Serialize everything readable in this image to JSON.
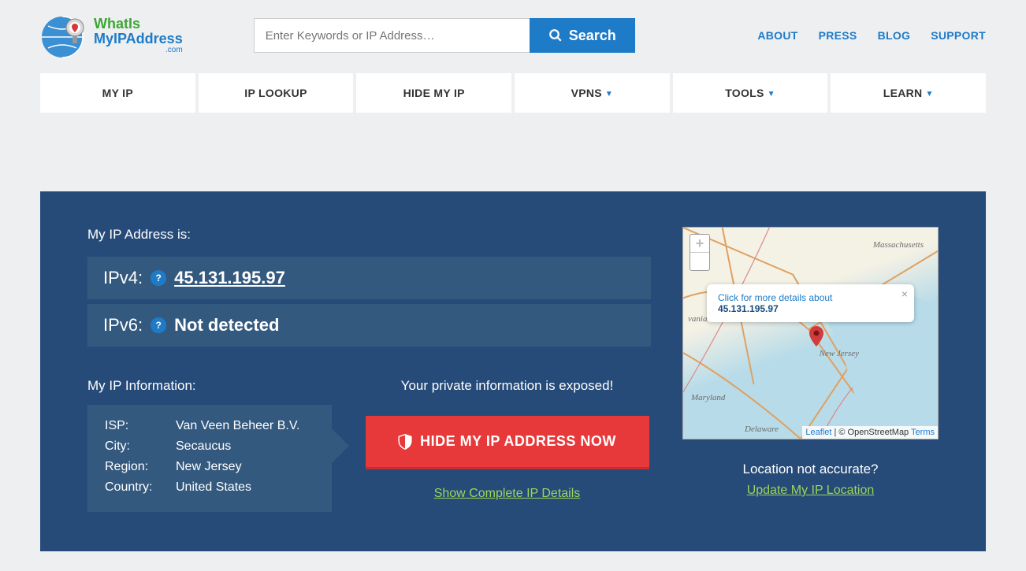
{
  "logo": {
    "line1": "WhatIs",
    "line2": "MyIPAddress",
    "line3": ".com"
  },
  "search": {
    "placeholder": "Enter Keywords or IP Address…",
    "button": "Search"
  },
  "topLinks": {
    "about": "ABOUT",
    "press": "PRESS",
    "blog": "BLOG",
    "support": "SUPPORT"
  },
  "nav": {
    "myip": "MY IP",
    "lookup": "IP LOOKUP",
    "hide": "HIDE MY IP",
    "vpns": "VPNS",
    "tools": "TOOLS",
    "learn": "LEARN"
  },
  "panel": {
    "title": "My IP Address is:",
    "ipv4Label": "IPv4:",
    "ipv4Value": "45.131.195.97",
    "ipv6Label": "IPv6:",
    "ipv6Value": "Not detected",
    "infoTitle": "My IP Information:",
    "ispLabel": "ISP:",
    "ispValue": "Van Veen Beheer B.V.",
    "cityLabel": "City:",
    "cityValue": "Secaucus",
    "regionLabel": "Region:",
    "regionValue": "New Jersey",
    "countryLabel": "Country:",
    "countryValue": "United States",
    "exposed": "Your private information is exposed!",
    "hideBtn": "HIDE MY IP ADDRESS NOW",
    "detailsLink": "Show Complete IP Details"
  },
  "map": {
    "zoomIn": "+",
    "zoomOut": "–",
    "popupPrefix": "Click for more details about ",
    "popupIp": "45.131.195.97",
    "labels": {
      "mass": "Massachusetts",
      "nj": "New Jersey",
      "md": "Maryland",
      "de": "Delaware",
      "pa": "vania"
    },
    "attr": {
      "leaflet": "Leaflet",
      "sep": " | © OpenStreetMap ",
      "terms": "Terms"
    },
    "below": "Location not accurate?",
    "update": "Update My IP Location"
  }
}
